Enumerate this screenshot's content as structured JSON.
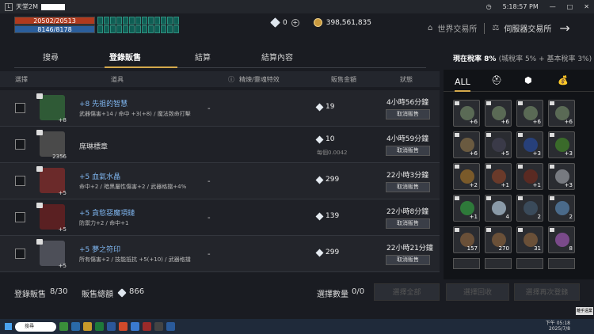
{
  "window": {
    "title": "天堂2M",
    "time": "5:18:57 PM"
  },
  "player": {
    "hp": "20502/20513",
    "mp": "8146/8178"
  },
  "currency": {
    "diamond": "0",
    "adena": "398,561,835"
  },
  "market": {
    "world": "世界交易所",
    "server": "伺服器交易所"
  },
  "tabs": [
    "搜尋",
    "登錄販售",
    "結算",
    "結算內容"
  ],
  "tax": {
    "label": "現在稅率",
    "value": "8%",
    "detail": "(城稅率 5% + 基本稅率 3%)"
  },
  "columns": {
    "select": "選擇",
    "item": "道具",
    "refine": "精煉/靈魂特效",
    "price": "販售金額",
    "status": "狀態"
  },
  "rows": [
    {
      "name": "+8 先祖的智慧",
      "stats": "武器傷害+14 / 命中 +3(+8) / 魔法致命打擊",
      "qty": "+8",
      "price": "19",
      "unit": "",
      "time": "4小時56分鐘",
      "cancel": "取消販售",
      "color": "#2f5a36"
    },
    {
      "name": "席琳標章",
      "stats": "",
      "qty": "2356",
      "price": "10",
      "unit": "每個0.0042",
      "time": "4小時59分鐘",
      "cancel": "取消販售",
      "color": "#4a4a4a"
    },
    {
      "name": "+5 血氣水晶",
      "stats": "命中+2 / 暗黑屬性傷害+2 / 武器格擋+4%",
      "qty": "+5",
      "price": "299",
      "unit": "",
      "time": "22小時3分鐘",
      "cancel": "取消販售",
      "color": "#6b2a2a"
    },
    {
      "name": "+5 貪慾惡魔項鏈",
      "stats": "防禦力+2 / 命中+1",
      "qty": "+5",
      "price": "139",
      "unit": "",
      "time": "22小時8分鐘",
      "cancel": "取消販售",
      "color": "#5a2022"
    },
    {
      "name": "+5 夢之符印",
      "stats": "所有傷害+2 / 技能抵抗 +5(+10) / 武器格擋",
      "qty": "+5",
      "price": "299",
      "unit": "",
      "time": "22小時21分鐘",
      "cancel": "取消販售",
      "color": "#4d4f58"
    }
  ],
  "footer": {
    "listed_label": "登錄販售",
    "listed": "8/30",
    "total_label": "販售總額",
    "total": "866",
    "sel_label": "選擇數量",
    "sel": "0/0",
    "btn_all": "選擇全部",
    "btn_recover": "選擇回收",
    "btn_relist": "選擇再次登錄"
  },
  "sidebar": {
    "all": "ALL",
    "tabs": [
      "helmet-icon",
      "box-icon",
      "money-icon"
    ],
    "items": [
      {
        "c": "+6",
        "col": "#5a6a55"
      },
      {
        "c": "+6",
        "col": "#5a6a55"
      },
      {
        "c": "+6",
        "col": "#5a6a55"
      },
      {
        "c": "+6",
        "col": "#5a6a55"
      },
      {
        "c": "+6",
        "col": "#6a5a40"
      },
      {
        "c": "+5",
        "col": "#3a3a48"
      },
      {
        "c": "+3",
        "col": "#27407a"
      },
      {
        "c": "+3",
        "col": "#3a6a2a"
      },
      {
        "c": "+2",
        "col": "#7a5a2a"
      },
      {
        "c": "+1",
        "col": "#6a3a2a"
      },
      {
        "c": "+1",
        "col": "#5a2a22"
      },
      {
        "c": "+3",
        "col": "#777a80"
      },
      {
        "c": "+1",
        "col": "#2e7a3a"
      },
      {
        "c": "4",
        "col": "#8a9aa8"
      },
      {
        "c": "2",
        "col": "#3a4a5a"
      },
      {
        "c": "2",
        "col": "#4a6a8a"
      },
      {
        "c": "157",
        "col": "#6a5038"
      },
      {
        "c": "270",
        "col": "#6a5038"
      },
      {
        "c": "31",
        "col": "#6a5038"
      },
      {
        "c": "8",
        "col": "#7a4a8a"
      }
    ]
  },
  "corner": "離手遠業",
  "taskbar": {
    "search": "搜尋",
    "time": "下午 05:18",
    "date": "2025/7/8"
  }
}
